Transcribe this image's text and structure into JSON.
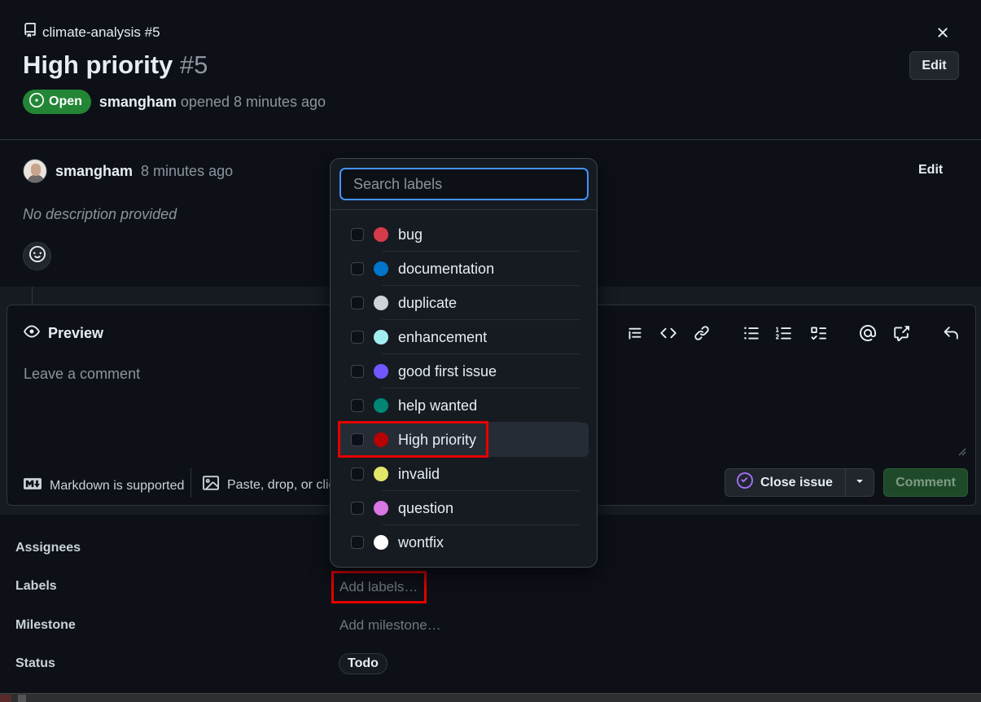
{
  "header": {
    "repo_crumb": "climate-analysis #5",
    "title": "High priority",
    "number": "#5",
    "edit_label": "Edit",
    "state_badge": "Open",
    "author": "smangham",
    "opened_text": "opened 8 minutes ago"
  },
  "comment": {
    "author": "smangham",
    "time": "8 minutes ago",
    "edit_label": "Edit",
    "body": "No description provided"
  },
  "editor": {
    "preview_label": "Preview",
    "placeholder": "Leave a comment",
    "markdown_note": "Markdown is supported",
    "paste_note": "Paste, drop, or clic",
    "close_issue_label": "Close issue",
    "comment_label": "Comment",
    "toolbar_icons": [
      "heading-icon",
      "code-icon",
      "link-icon",
      "bullet-list-icon",
      "numbered-list-icon",
      "task-list-icon",
      "mention-icon",
      "cross-reference-icon",
      "reply-icon"
    ]
  },
  "sidebar": {
    "assignees_label": "Assignees",
    "labels_label": "Labels",
    "labels_value": "Add labels…",
    "milestone_label": "Milestone",
    "milestone_value": "Add milestone…",
    "status_label": "Status",
    "status_value": "Todo"
  },
  "labels_dropdown": {
    "search_placeholder": "Search labels",
    "items": [
      {
        "name": "bug",
        "color": "#d73a4a",
        "checked": false
      },
      {
        "name": "documentation",
        "color": "#0075ca",
        "checked": false
      },
      {
        "name": "duplicate",
        "color": "#cfd3d7",
        "checked": false
      },
      {
        "name": "enhancement",
        "color": "#a2eeef",
        "checked": false
      },
      {
        "name": "good first issue",
        "color": "#7057ff",
        "checked": false
      },
      {
        "name": "help wanted",
        "color": "#008672",
        "checked": false
      },
      {
        "name": "High priority",
        "color": "#b60205",
        "checked": false,
        "highlighted": true
      },
      {
        "name": "invalid",
        "color": "#e4e669",
        "checked": false
      },
      {
        "name": "question",
        "color": "#d876e3",
        "checked": false
      },
      {
        "name": "wontfix",
        "color": "#ffffff",
        "checked": false
      }
    ]
  },
  "colors": {
    "background": "#0d1117",
    "open_green": "#238636",
    "focus_blue": "#4493f8",
    "annotation_red": "#e60000",
    "close_issue_purple": "#a371f7"
  }
}
